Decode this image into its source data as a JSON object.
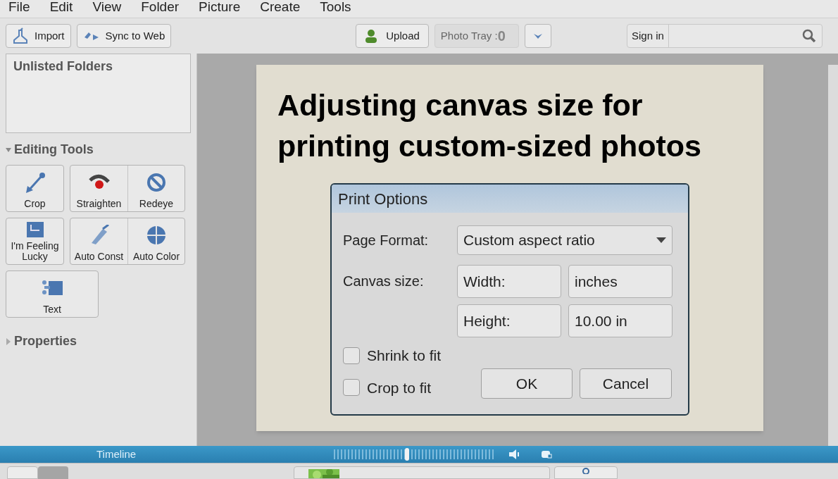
{
  "menu": [
    "File",
    "Edit",
    "View",
    "Folder",
    "Picture",
    "Create",
    "Tools"
  ],
  "toolbar": {
    "import": "Import",
    "sync": "Sync to Web",
    "upload": "Upload",
    "photo_tray": {
      "label": "Photo Tray :",
      "count": "0"
    },
    "sign_in": "Sign in"
  },
  "sidebar": {
    "folders_title": "Unlisted Folders",
    "editing_tools": {
      "title": "Editing Tools",
      "expanded": true,
      "rows": [
        [
          [
            "Crop"
          ],
          [
            "Straighten",
            "Redeye"
          ]
        ],
        [
          [
            "I'm Feeling Lucky"
          ],
          [
            "Auto Const",
            "Auto Color"
          ]
        ],
        [
          [
            "Text"
          ]
        ]
      ]
    },
    "properties": {
      "title": "Properties",
      "expanded": false
    }
  },
  "slide": {
    "title": "Adjusting canvas size for printing custom-sized photos"
  },
  "dialog": {
    "title": "Print Options",
    "page_format_label": "Page Format:",
    "page_format": "Custom aspect ratio",
    "canvas_label": "Canvas size:",
    "width_label": "Width:",
    "width_unit": "inches",
    "height_label": "Height:",
    "height_value": "10.00 in",
    "checks": [
      {
        "label": "Shrink to fit",
        "checked": false
      },
      {
        "label": "Crop to fit",
        "checked": false
      }
    ],
    "ok": "OK",
    "cancel": "Cancel"
  },
  "timeline": {
    "label": "Timeline",
    "level": 0.45
  }
}
